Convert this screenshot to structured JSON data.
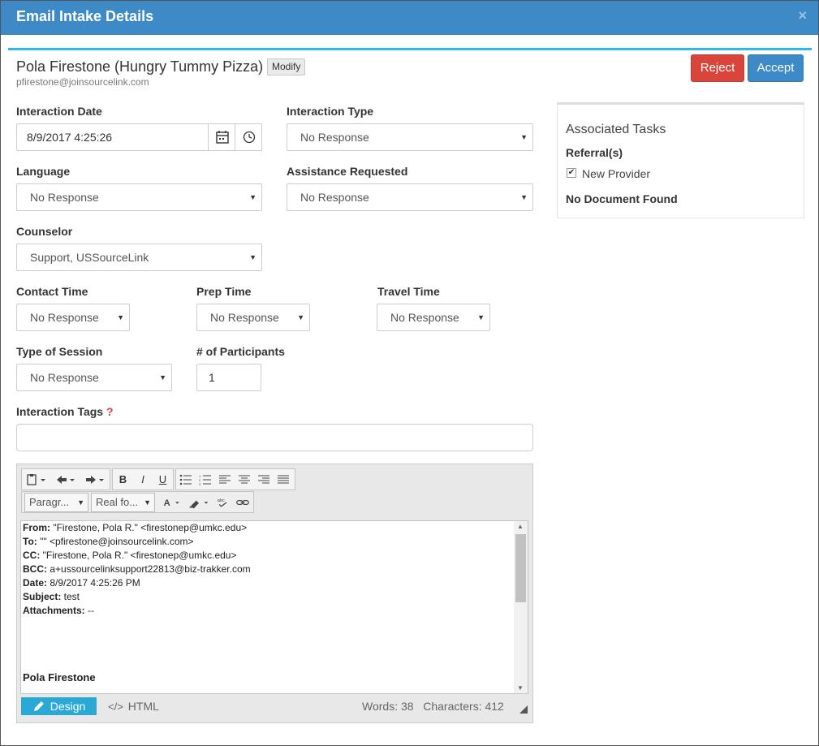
{
  "dialog": {
    "title": "Email Intake Details",
    "close": "×"
  },
  "header": {
    "name": "Pola Firestone (Hungry Tummy Pizza)",
    "modify_label": "Modify",
    "email": "pfirestone@joinsourcelink.com",
    "reject_label": "Reject",
    "accept_label": "Accept"
  },
  "form": {
    "interaction_date": {
      "label": "Interaction Date",
      "value": "8/9/2017 4:25:26"
    },
    "interaction_type": {
      "label": "Interaction Type",
      "value": "No Response"
    },
    "language": {
      "label": "Language",
      "value": "No Response"
    },
    "assistance_requested": {
      "label": "Assistance Requested",
      "value": "No Response"
    },
    "counselor": {
      "label": "Counselor",
      "value": "Support, USSourceLink"
    },
    "contact_time": {
      "label": "Contact Time",
      "value": "No Response"
    },
    "prep_time": {
      "label": "Prep Time",
      "value": "No Response"
    },
    "travel_time": {
      "label": "Travel Time",
      "value": "No Response"
    },
    "type_of_session": {
      "label": "Type of Session",
      "value": "No Response"
    },
    "participants": {
      "label": "# of Participants",
      "value": "1"
    },
    "interaction_tags": {
      "label": "Interaction Tags",
      "help": "?",
      "value": ""
    }
  },
  "tasks": {
    "heading": "Associated Tasks",
    "referrals_label": "Referral(s)",
    "referral_item": "New Provider",
    "referral_checked": true,
    "no_document": "No Document Found"
  },
  "editor": {
    "paragraph_dropdown": "Paragr...",
    "font_dropdown": "Real fo...",
    "bold": "B",
    "italic": "I",
    "underline": "U",
    "email_lines": [
      {
        "key": "From:",
        "value": " \"Firestone, Pola R.\" <firestonep@umkc.edu>"
      },
      {
        "key": "To:",
        "value": " \"\" <pfirestone@joinsourcelink.com>"
      },
      {
        "key": "CC:",
        "value": " \"Firestone, Pola R.\" <firestonep@umkc.edu>"
      },
      {
        "key": "BCC:",
        "value": " a+ussourcelinksupport22813@biz-trakker.com"
      },
      {
        "key": "Date:",
        "value": " 8/9/2017 4:25:26 PM"
      },
      {
        "key": "Subject:",
        "value": " test"
      },
      {
        "key": "Attachments:",
        "value": " --"
      }
    ],
    "signature": "Pola Firestone",
    "design_label": "Design",
    "html_label": "HTML",
    "words": "Words: 38",
    "characters": "Characters: 412"
  },
  "colors": {
    "header_bar": "#3d8ac7",
    "accent": "#2cb9e6",
    "reject": "#d9443b",
    "accept": "#3d8ac7",
    "design_button": "#2aa8d6"
  }
}
